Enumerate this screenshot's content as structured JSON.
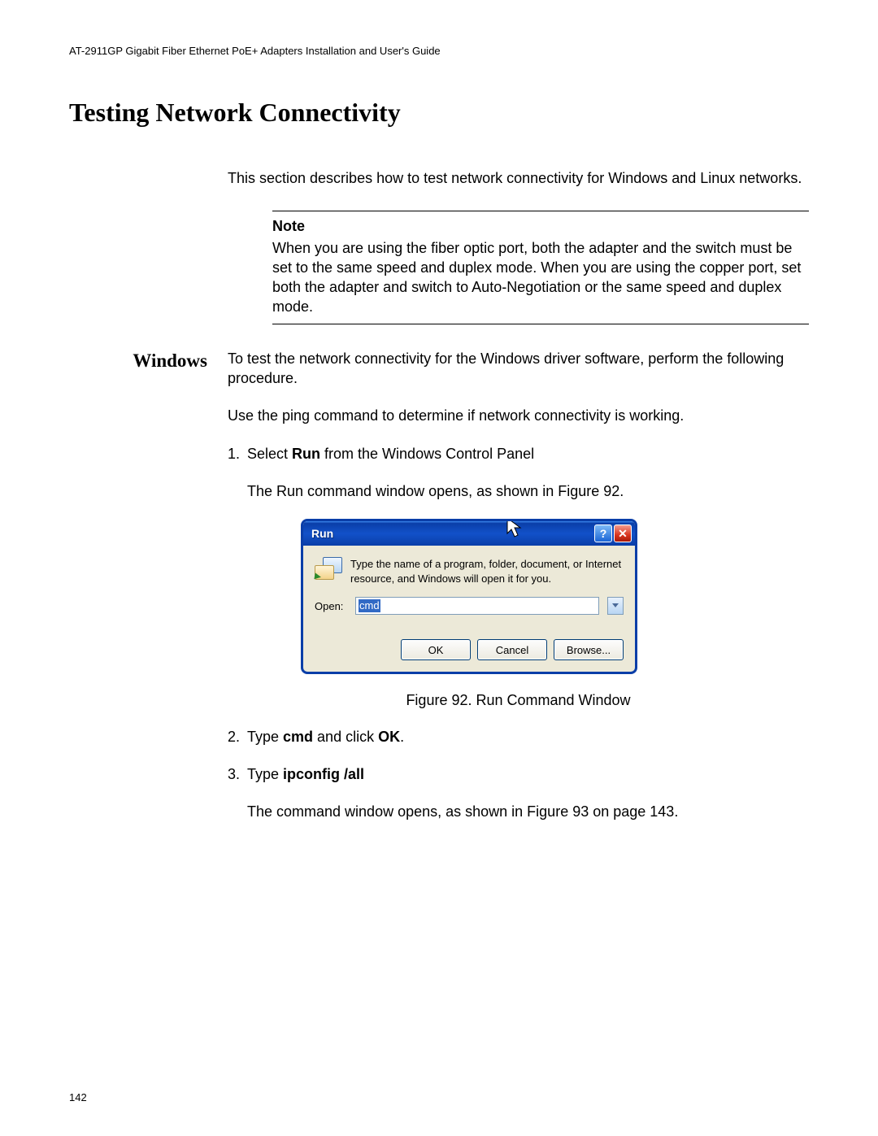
{
  "header": {
    "running": "AT-2911GP Gigabit Fiber Ethernet PoE+ Adapters Installation and User's Guide"
  },
  "section_title": "Testing Network Connectivity",
  "intro": "This section describes how to test network connectivity for Windows and Linux networks.",
  "note": {
    "label": "Note",
    "text": "When you are using the fiber optic port, both the adapter and the switch must be set to the same speed and duplex mode. When you are using the copper port, set both the adapter and switch to Auto-Negotiation or the same speed and duplex mode."
  },
  "side_label": "Windows",
  "windows": {
    "p1": "To test the network connectivity for the Windows driver software, perform the following procedure.",
    "p2": "Use the ping command to determine if network connectivity is working.",
    "step1_pre": "Select ",
    "step1_bold": "Run",
    "step1_post": " from the Windows Control Panel",
    "step1_after": "The Run command window opens, as shown in Figure 92.",
    "fig_caption": "Figure 92. Run Command Window",
    "step2_pre": "Type ",
    "step2_bold1": "cmd",
    "step2_mid": " and click ",
    "step2_bold2": "OK",
    "step2_post": ".",
    "step3_pre": "Type ",
    "step3_bold": "ipconfig /all",
    "step3_after": "The command window opens, as shown in Figure 93 on page 143."
  },
  "run_dialog": {
    "title": "Run",
    "desc": "Type the name of a program, folder, document, or Internet resource, and Windows will open it for you.",
    "open_label": "Open:",
    "open_value": "cmd",
    "ok": "OK",
    "cancel": "Cancel",
    "browse": "Browse...",
    "help_btn": "?",
    "close_btn": "✕"
  },
  "page_number": "142"
}
